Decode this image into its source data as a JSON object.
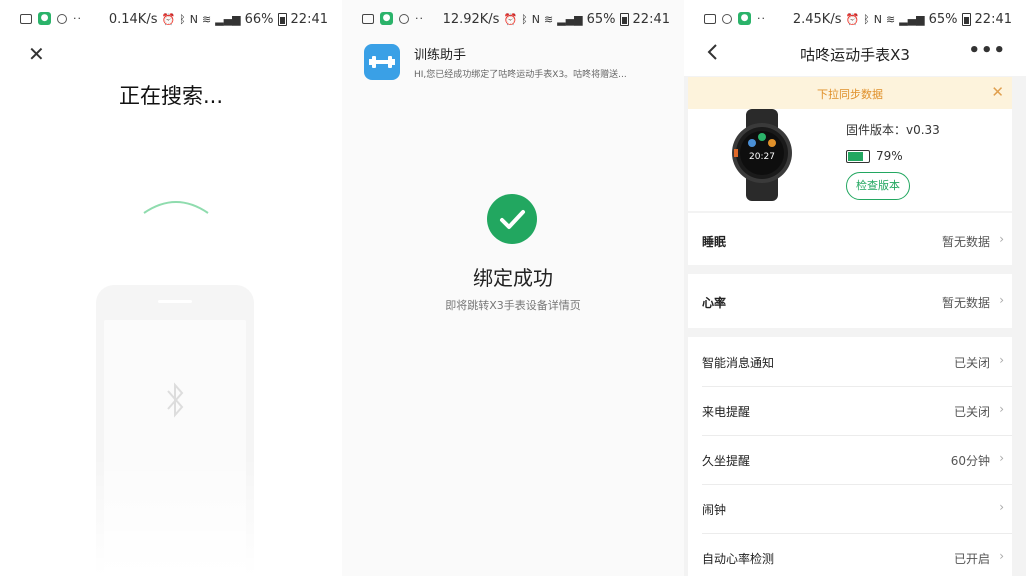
{
  "colors": {
    "accent_green": "#22a760",
    "banner_bg": "#fdf3dc",
    "banner_text": "#e0902a",
    "notif_icon": "#3aa0e6"
  },
  "panel1": {
    "status": {
      "speed": "0.14K/s",
      "battery": "66%",
      "time": "22:41",
      "icons": [
        "gallery-icon",
        "app-icon",
        "search-icon",
        "more-dots"
      ]
    },
    "title": "正在搜索...",
    "icons": [
      "close-icon",
      "bluetooth-icon",
      "phone-icon",
      "search-arc"
    ]
  },
  "panel2": {
    "status": {
      "speed": "12.92K/s",
      "battery": "65%",
      "time": "22:41"
    },
    "notification": {
      "app": "训练助手",
      "text": "HI,您已经成功绑定了咕咚运动手表X3。咕咚将赠送..."
    },
    "success_title": "绑定成功",
    "success_sub": "即将跳转X3手表设备详情页"
  },
  "panel3": {
    "status": {
      "speed": "2.45K/s",
      "battery": "65%",
      "time": "22:41"
    },
    "title": "咕咚运动手表X3",
    "sync_banner": "下拉同步数据",
    "firmware": "固件版本：v0.33",
    "battery_pct": "79%",
    "battery_level": 0.79,
    "check_version": "检查版本",
    "watch_time": "20:27",
    "rows": [
      {
        "label": "睡眠",
        "value": "暂无数据"
      },
      {
        "label": "心率",
        "value": "暂无数据"
      },
      {
        "label": "智能消息通知",
        "value": "已关闭"
      },
      {
        "label": "来电提醒",
        "value": "已关闭"
      },
      {
        "label": "久坐提醒",
        "value": "60分钟"
      },
      {
        "label": "闹钟",
        "value": ""
      },
      {
        "label": "自动心率检测",
        "value": "已开启"
      }
    ]
  }
}
